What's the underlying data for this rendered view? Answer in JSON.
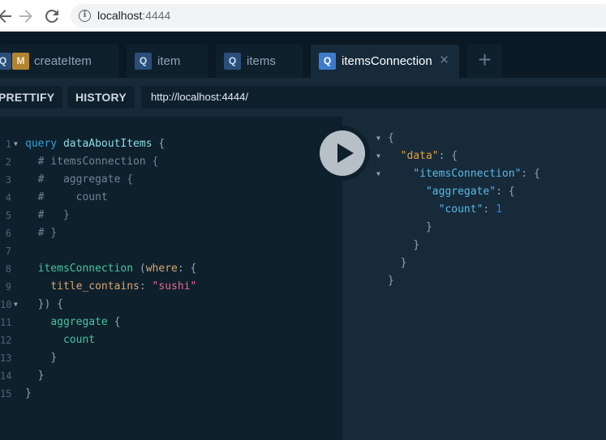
{
  "browser": {
    "back_icon": "arrow-left-icon",
    "forward_icon": "arrow-right-icon",
    "reload_icon": "reload-icon",
    "info_icon": "info-icon",
    "url_host": "localhost",
    "url_port": ":4444"
  },
  "tabs": [
    {
      "badges": [
        "Q",
        "M"
      ],
      "label": "createItem"
    },
    {
      "badges": [
        "Q"
      ],
      "label": "item"
    },
    {
      "badges": [
        "Q"
      ],
      "label": "items"
    },
    {
      "badges": [
        "Q"
      ],
      "label": "itemsConnection",
      "close": "×"
    }
  ],
  "add_tab_label": "+",
  "toolbar": {
    "prettify_label": "PRETTIFY",
    "history_label": "HISTORY",
    "endpoint": "http://localhost:4444/"
  },
  "editor": {
    "line_numbers": [
      "1",
      "2",
      "3",
      "4",
      "5",
      "6",
      "7",
      "8",
      "9",
      "10",
      "11",
      "12",
      "13",
      "14",
      "15"
    ],
    "query_keyword": "query",
    "operation_name": "dataAboutItems",
    "comments": [
      "# itemsConnection {",
      "#   aggregate {",
      "#     count",
      "#   }",
      "# }"
    ],
    "field_connection": "itemsConnection",
    "arg_name": "where",
    "input_key": "title_contains",
    "input_value": "\"sushi\"",
    "field_aggregate": "aggregate",
    "field_count": "count"
  },
  "result": {
    "key_data": "\"data\"",
    "key_connection": "\"itemsConnection\"",
    "key_aggregate": "\"aggregate\"",
    "key_count": "\"count\"",
    "count_value": "1"
  },
  "colors": {
    "background": "#0f202d",
    "result_panel": "#172a3a",
    "accent": "#3e7bcc"
  }
}
